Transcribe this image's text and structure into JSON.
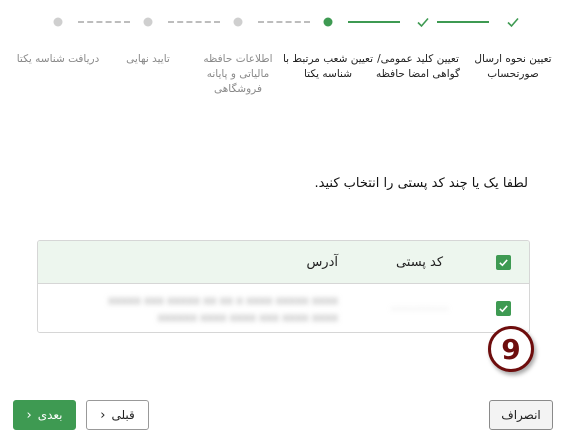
{
  "stepper": {
    "steps": [
      {
        "label": "تعیین نحوه ارسال صورتحساب",
        "state": "done"
      },
      {
        "label": "تعیین کلید عمومی/ گواهی امضا حافظه",
        "state": "done"
      },
      {
        "label": "تعیین شعب مرتبط با شناسه یکتا",
        "state": "active"
      },
      {
        "label": "اطلاعات حافظه مالیاتی و پایانه فروشگاهی",
        "state": "todo"
      },
      {
        "label": "تایید نهایی",
        "state": "todo"
      },
      {
        "label": "دریافت شناسه یکتا",
        "state": "todo"
      }
    ],
    "accent_color": "#3e9a52",
    "inactive_color": "#cfcfcf"
  },
  "prompt": "لطفا یک یا چند کد پستی را انتخاب کنید.",
  "table": {
    "headers": {
      "code": "کد پستی",
      "address": "آدرس"
    },
    "rows": [
      {
        "code": "۰۰۰۰۰۰۰۰۰۰",
        "address_line1": "xxxxx xxx xxxxx xx xx x xxxx xxxxx xxxx",
        "address_line2": "xxxxxx xxxx xxxx xxx xxxx xxxx",
        "checked": true
      }
    ],
    "header_bg": "#edf6ee"
  },
  "badge": {
    "number": "9",
    "color": "#6e0d0d"
  },
  "buttons": {
    "next": "بعدی",
    "prev": "قبلی",
    "cancel": "انصراف"
  }
}
